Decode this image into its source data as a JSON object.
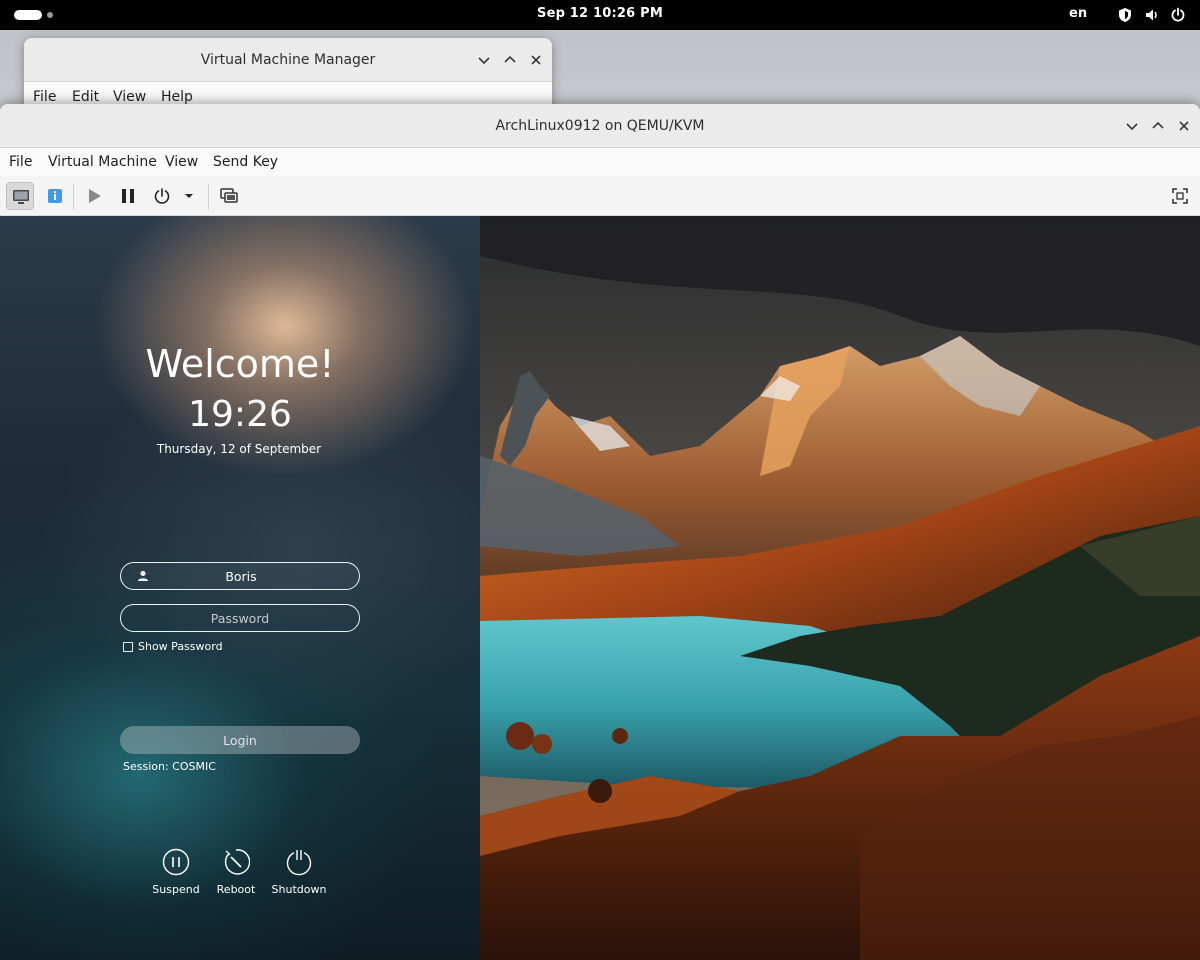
{
  "topbar": {
    "clock": "Sep 12  10:26 PM",
    "language": "en",
    "tray_icons": [
      "shield-icon",
      "volume-icon",
      "power-icon"
    ]
  },
  "vmm_window": {
    "title": "Virtual Machine Manager",
    "menu": [
      "File",
      "Edit",
      "View",
      "Help"
    ]
  },
  "vm_window": {
    "title": "ArchLinux0912 on QEMU/KVM",
    "menu": [
      "File",
      "Virtual Machine",
      "View",
      "Send Key"
    ],
    "toolbar_icons": [
      "console-icon",
      "info-icon",
      "play-icon",
      "pause-icon",
      "shutdown-icon",
      "chevron-down-icon",
      "snapshot-icon",
      "fullscreen-icon"
    ]
  },
  "greeter": {
    "welcome": "Welcome!",
    "time": "19:26",
    "date": "Thursday, 12 of September",
    "username": "Boris",
    "password_placeholder": "Password",
    "show_password": "Show Password",
    "login": "Login",
    "session": "Session: COSMIC",
    "power": {
      "suspend": "Suspend",
      "reboot": "Reboot",
      "shutdown": "Shutdown"
    }
  },
  "colors": {
    "topbar": "#000000",
    "titlebar": "#ebebeb",
    "menubar": "#fafafa",
    "info_accent": "#3d9be9"
  }
}
